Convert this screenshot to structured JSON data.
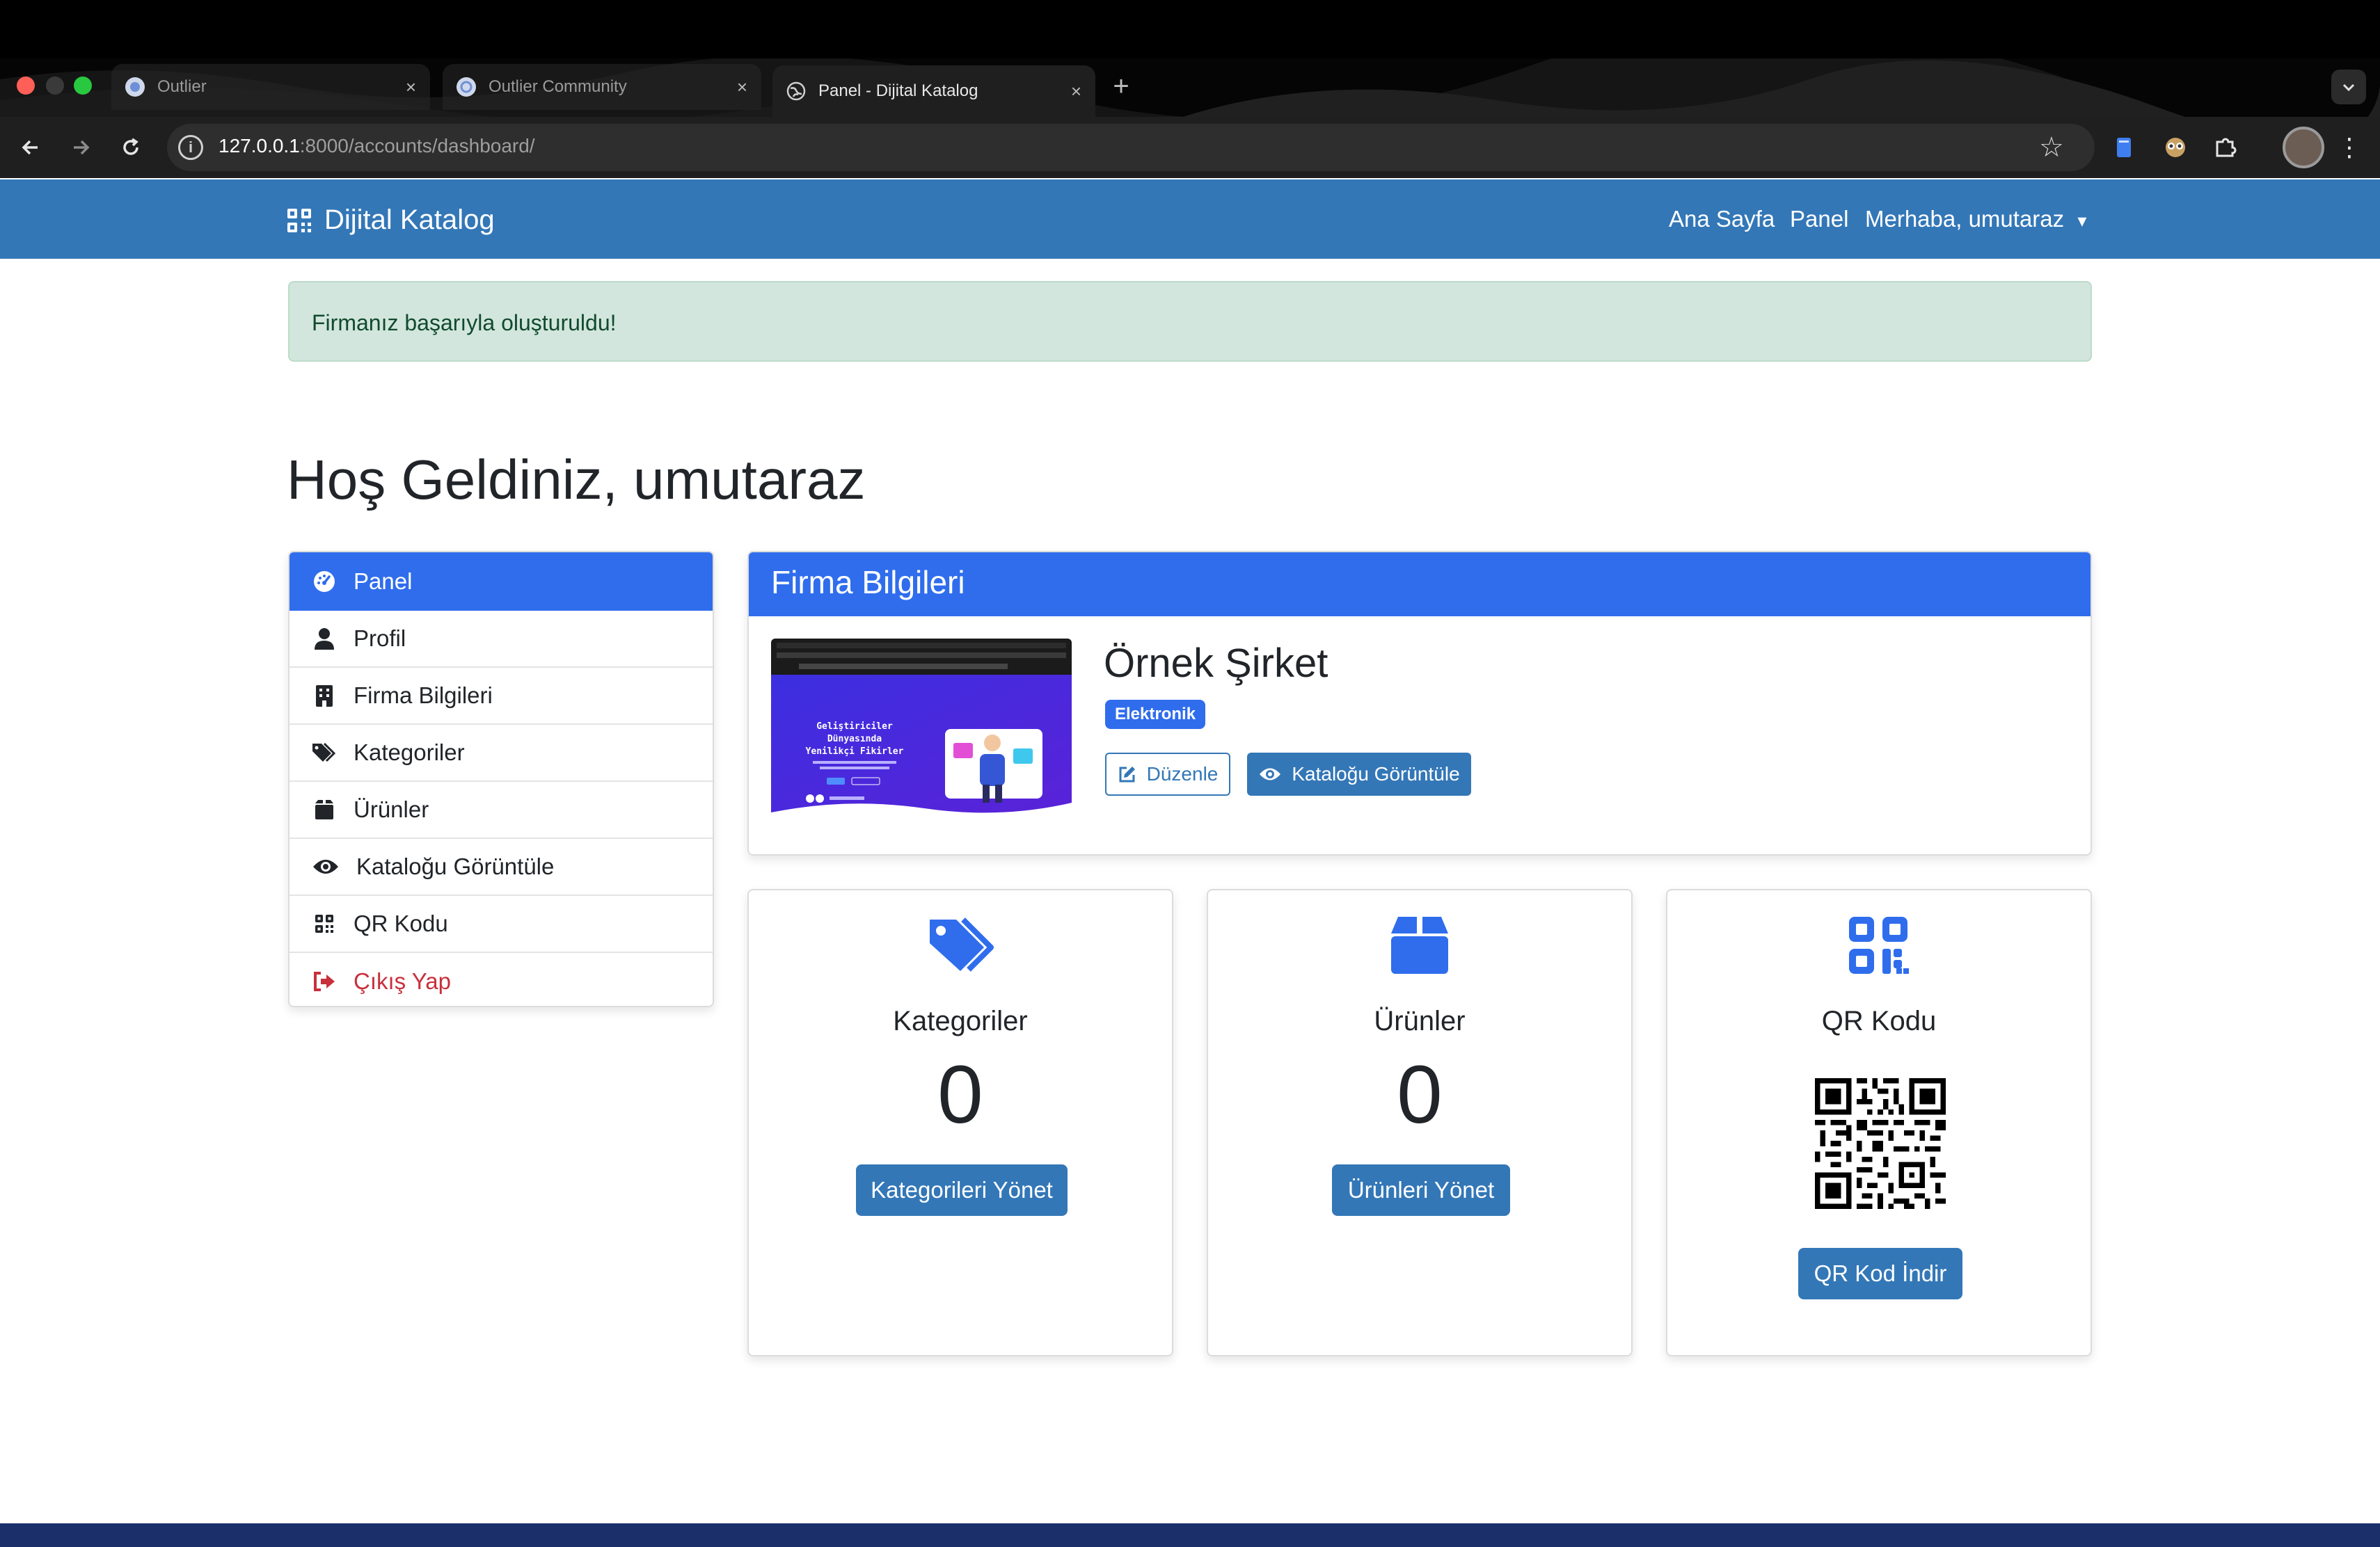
{
  "browser": {
    "tabs": [
      {
        "title": "Outlier",
        "active": false
      },
      {
        "title": "Outlier Community",
        "active": false
      },
      {
        "title": "Panel - Dijital Katalog",
        "active": true
      }
    ],
    "close_glyph": "×",
    "new_tab_glyph": "+",
    "url_host": "127.0.0.1",
    "url_rest": ":8000/accounts/dashboard/"
  },
  "navbar": {
    "brand": "Dijital Katalog",
    "links": [
      "Ana Sayfa",
      "Panel"
    ],
    "user_menu": "Merhaba, umutaraz",
    "caret": "▾"
  },
  "alert": {
    "message": "Firmanız başarıyla oluşturuldu!"
  },
  "welcome": {
    "heading": "Hoş Geldiniz, umutaraz"
  },
  "sidebar": {
    "items": [
      {
        "label": "Panel",
        "icon": "gauge-icon"
      },
      {
        "label": "Profil",
        "icon": "user-icon"
      },
      {
        "label": "Firma Bilgileri",
        "icon": "building-icon"
      },
      {
        "label": "Kategoriler",
        "icon": "tags-icon"
      },
      {
        "label": "Ürünler",
        "icon": "box-icon"
      },
      {
        "label": "Kataloğu Görüntüle",
        "icon": "eye-icon"
      },
      {
        "label": "QR Kodu",
        "icon": "qrcode-icon"
      },
      {
        "label": "Çıkış Yap",
        "icon": "logout-icon"
      }
    ]
  },
  "firm": {
    "header": "Firma Bilgileri",
    "name": "Örnek Şirket",
    "category": "Elektronik",
    "edit_label": "Düzenle",
    "view_label": "Kataloğu Görüntüle",
    "thumbnail": {
      "headline_1": "Geliştiriciler",
      "headline_2": "Dünyasında",
      "headline_3": "Yenilikçi Fikirler"
    }
  },
  "stats": {
    "categories": {
      "title": "Kategoriler",
      "value": "0",
      "button": "Kategorileri Yönet"
    },
    "products": {
      "title": "Ürünler",
      "value": "0",
      "button": "Ürünleri Yönet"
    },
    "qr": {
      "title": "QR Kodu",
      "button": "QR Kod İndir"
    }
  },
  "colors": {
    "primary": "#2f6ded",
    "navbar": "#3377b7",
    "danger": "#c8303c",
    "alert_bg": "#d2e6dd",
    "footer": "#1b2f6b"
  }
}
